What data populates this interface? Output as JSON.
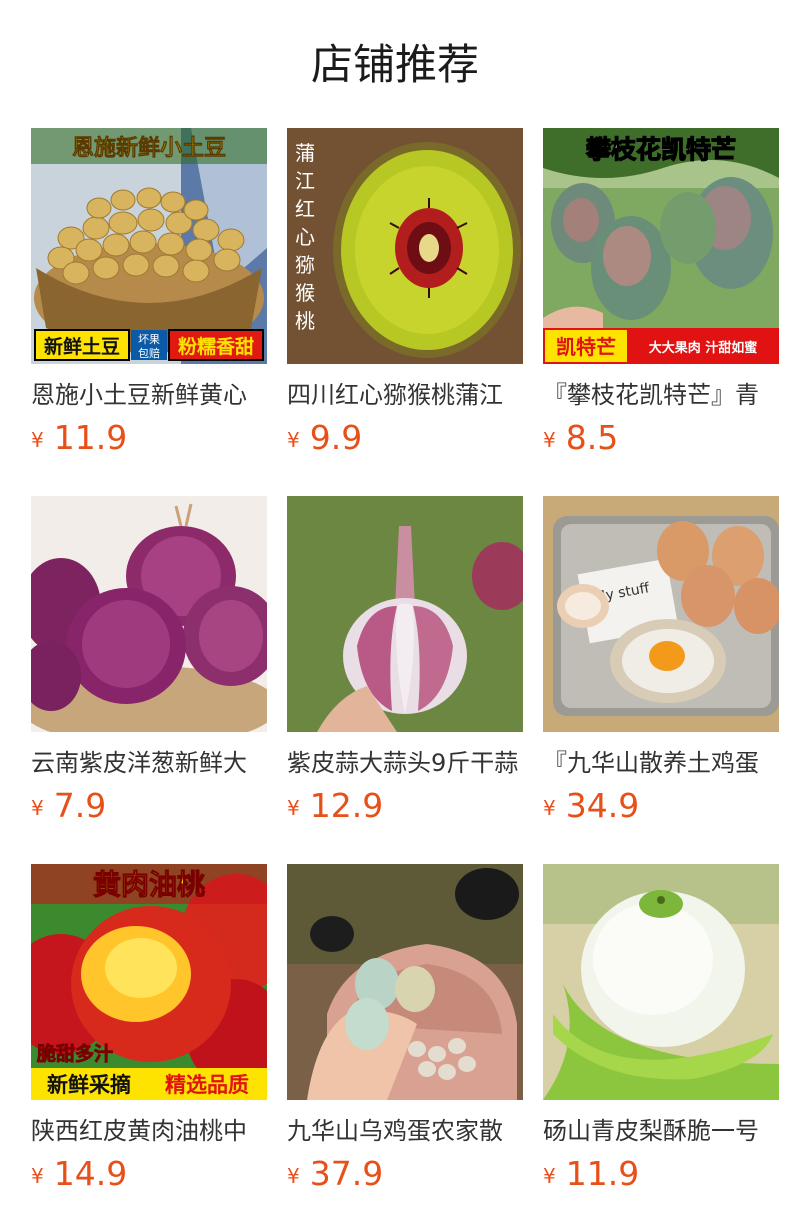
{
  "header": {
    "title": "店铺推荐"
  },
  "products": [
    {
      "name": "恩施小土豆新鲜黄心",
      "currency": "¥",
      "price": "11.9",
      "image": {
        "icon": "potato-basket-image",
        "top_banner": "恩施新鲜小土豆",
        "bottom_left": "新鲜土豆",
        "badge_top": "坏果",
        "badge_bottom": "包赔",
        "bottom_right": "粉糯香甜"
      }
    },
    {
      "name": "四川红心猕猴桃蒲江",
      "currency": "¥",
      "price": "9.9",
      "image": {
        "icon": "kiwi-fruit-image",
        "vertical_text": [
          "蒲",
          "江",
          "红",
          "心",
          "猕",
          "猴",
          "桃"
        ]
      }
    },
    {
      "name": "『攀枝花凯特芒』青",
      "currency": "¥",
      "price": "8.5",
      "image": {
        "icon": "mango-tree-image",
        "top_banner": "攀枝花凯特芒",
        "bottom_left": "凯特芒",
        "bottom_right": "大大果肉 汁甜如蜜"
      }
    },
    {
      "name": "云南紫皮洋葱新鲜大",
      "currency": "¥",
      "price": "7.9",
      "image": {
        "icon": "red-onion-image"
      }
    },
    {
      "name": "紫皮蒜大蒜头9斤干蒜",
      "currency": "¥",
      "price": "12.9",
      "image": {
        "icon": "garlic-bulb-image"
      }
    },
    {
      "name": "『九华山散养土鸡蛋",
      "currency": "¥",
      "price": "34.9",
      "image": {
        "icon": "eggs-tray-image",
        "package_text": "My stuff"
      }
    },
    {
      "name": "陕西红皮黄肉油桃中",
      "currency": "¥",
      "price": "14.9",
      "image": {
        "icon": "nectarine-image",
        "top_banner": "黄肉油桃",
        "mid_text": "脆甜多汁",
        "bottom_left": "新鲜采摘",
        "bottom_right": "精选品质"
      }
    },
    {
      "name": "九华山乌鸡蛋农家散",
      "currency": "¥",
      "price": "37.9",
      "image": {
        "icon": "green-eggs-hand-image"
      }
    },
    {
      "name": "砀山青皮梨酥脆一号",
      "currency": "¥",
      "price": "11.9",
      "image": {
        "icon": "peeled-pear-image"
      }
    }
  ]
}
